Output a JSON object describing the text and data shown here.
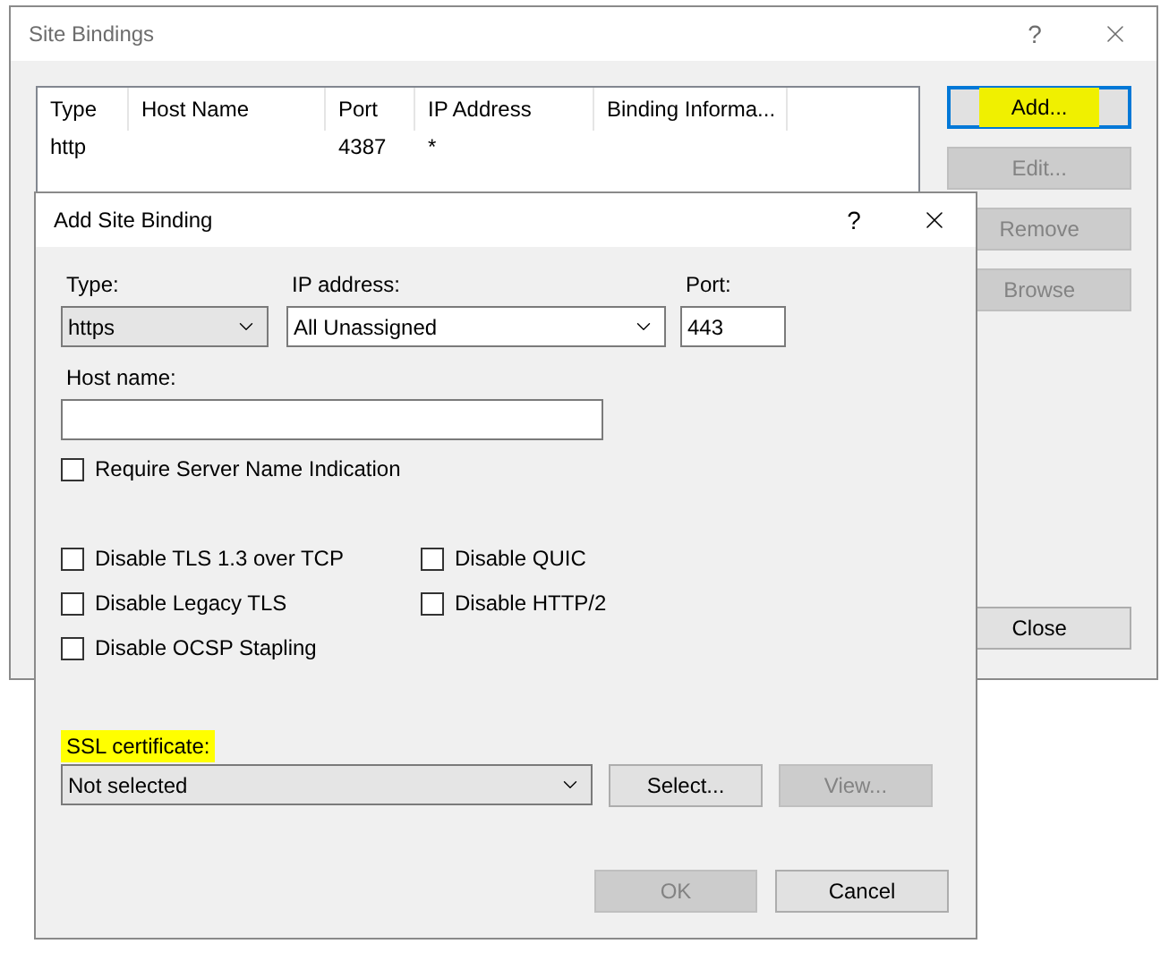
{
  "site_bindings": {
    "title": "Site Bindings",
    "help": "?",
    "table": {
      "columns": [
        "Type",
        "Host Name",
        "Port",
        "IP Address",
        "Binding Informa..."
      ],
      "rows": [
        {
          "type": "http",
          "port": "4387",
          "ip_address": "*"
        }
      ]
    },
    "buttons": [
      {
        "label": "Add...",
        "disabled": false,
        "highlighted": true
      },
      {
        "label": "Edit...",
        "disabled": true,
        "highlighted": false
      },
      {
        "label": "Remove",
        "disabled": true,
        "highlighted": false
      },
      {
        "label": "Browse",
        "disabled": true,
        "highlighted": false
      }
    ],
    "close_button": "Close"
  },
  "add_site_binding": {
    "title": "Add Site Binding",
    "help": "?",
    "type": {
      "label": "Type:",
      "value": "https"
    },
    "ip_address": {
      "label": "IP address:",
      "value": "All Unassigned"
    },
    "port": {
      "label": "Port:",
      "value": "443"
    },
    "host_name": {
      "label": "Host name:"
    },
    "require_sni": {
      "label": "Require Server Name Indication",
      "checked": false
    },
    "options": [
      {
        "label": "Disable TLS 1.3 over TCP",
        "checked": false
      },
      {
        "label": "Disable QUIC",
        "checked": false
      },
      {
        "label": "Disable Legacy TLS",
        "checked": false
      },
      {
        "label": "Disable HTTP/2",
        "checked": false
      },
      {
        "label": "Disable OCSP Stapling",
        "checked": false
      }
    ],
    "ssl_certificate": {
      "label": "SSL certificate:",
      "highlighted": true,
      "value": "Not selected"
    },
    "cert_buttons": [
      {
        "label": "Select...",
        "disabled": false
      },
      {
        "label": "View...",
        "disabled": true
      }
    ],
    "footer_buttons": [
      {
        "label": "OK",
        "disabled": true
      },
      {
        "label": "Cancel",
        "disabled": false
      }
    ]
  }
}
